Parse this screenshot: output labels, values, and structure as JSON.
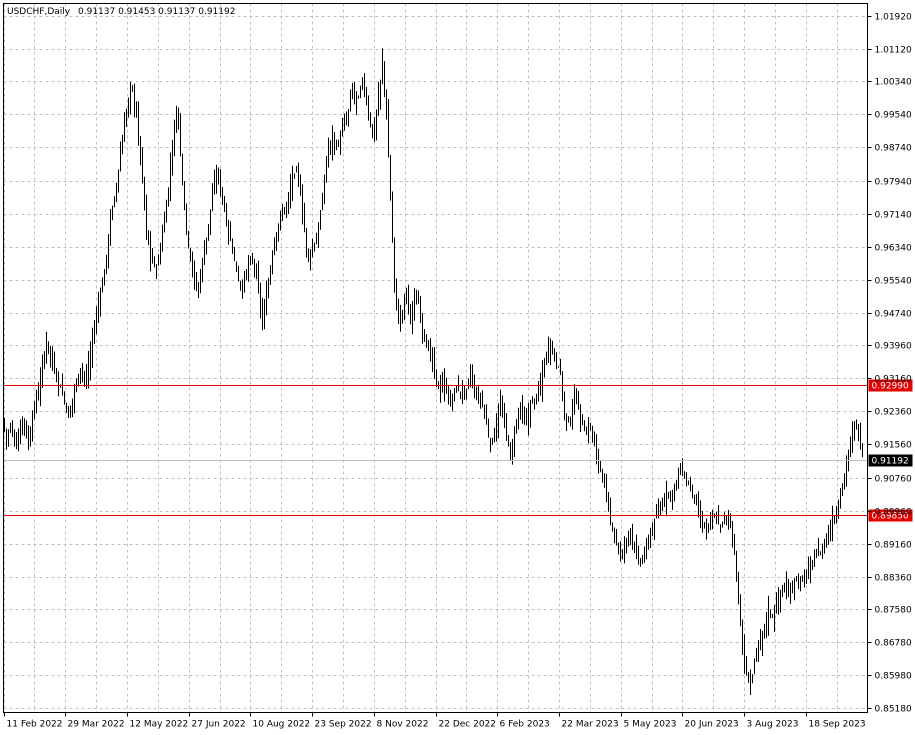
{
  "chart_data": {
    "type": "ohlc",
    "symbol_label": "USDCHF,Daily",
    "ohlc_label": "0.91137 0.91453 0.91137 0.91192",
    "last_price": 0.91192,
    "levels": [
      {
        "label": "0.92990",
        "value": 0.9299,
        "color": "#e00000"
      },
      {
        "label": "0.89850",
        "value": 0.8985,
        "color": "#e00000"
      }
    ],
    "y_ticks": [
      "1.01920",
      "1.01120",
      "1.00340",
      "0.99540",
      "0.98740",
      "0.97940",
      "0.97140",
      "0.96340",
      "0.95540",
      "0.94740",
      "0.93960",
      "0.93160",
      "0.92360",
      "0.91560",
      "0.90760",
      "0.89960",
      "0.89160",
      "0.88360",
      "0.87580",
      "0.86780",
      "0.85980",
      "0.85180"
    ],
    "x_ticks": [
      "11 Feb 2022",
      "29 Mar 2022",
      "12 May 2022",
      "27 Jun 2022",
      "10 Aug 2022",
      "23 Sep 2022",
      "8 Nov 2022",
      "22 Dec 2022",
      "6 Feb 2023",
      "22 Mar 2023",
      "5 May 2023",
      "20 Jun 2023",
      "3 Aug 2023",
      "18 Sep 2023"
    ],
    "ylim": [
      0.8508,
      1.0222
    ],
    "grid": true,
    "path_points": [
      [
        0,
        0.924
      ],
      [
        6,
        0.917
      ],
      [
        10,
        0.92
      ],
      [
        16,
        0.915
      ],
      [
        22,
        0.922
      ],
      [
        28,
        0.916
      ],
      [
        34,
        0.925
      ],
      [
        40,
        0.931
      ],
      [
        46,
        0.941
      ],
      [
        50,
        0.937
      ],
      [
        56,
        0.932
      ],
      [
        62,
        0.928
      ],
      [
        68,
        0.922
      ],
      [
        74,
        0.929
      ],
      [
        80,
        0.934
      ],
      [
        86,
        0.931
      ],
      [
        92,
        0.941
      ],
      [
        98,
        0.95
      ],
      [
        104,
        0.957
      ],
      [
        110,
        0.97
      ],
      [
        116,
        0.978
      ],
      [
        121,
        0.988
      ],
      [
        126,
        0.996
      ],
      [
        131,
        1.003
      ],
      [
        136,
        0.995
      ],
      [
        141,
        0.983
      ],
      [
        146,
        0.967
      ],
      [
        151,
        0.96
      ],
      [
        157,
        0.958
      ],
      [
        162,
        0.967
      ],
      [
        167,
        0.975
      ],
      [
        172,
        0.988
      ],
      [
        177,
        0.998
      ],
      [
        182,
        0.979
      ],
      [
        187,
        0.965
      ],
      [
        192,
        0.958
      ],
      [
        197,
        0.952
      ],
      [
        202,
        0.96
      ],
      [
        207,
        0.967
      ],
      [
        212,
        0.976
      ],
      [
        217,
        0.982
      ],
      [
        222,
        0.975
      ],
      [
        227,
        0.968
      ],
      [
        232,
        0.963
      ],
      [
        237,
        0.956
      ],
      [
        242,
        0.953
      ],
      [
        247,
        0.959
      ],
      [
        252,
        0.96
      ],
      [
        257,
        0.955
      ],
      [
        262,
        0.945
      ],
      [
        267,
        0.953
      ],
      [
        272,
        0.962
      ],
      [
        277,
        0.968
      ],
      [
        282,
        0.972
      ],
      [
        287,
        0.974
      ],
      [
        292,
        0.98
      ],
      [
        297,
        0.982
      ],
      [
        302,
        0.972
      ],
      [
        307,
        0.96
      ],
      [
        312,
        0.963
      ],
      [
        317,
        0.966
      ],
      [
        322,
        0.975
      ],
      [
        327,
        0.987
      ],
      [
        332,
        0.99
      ],
      [
        337,
        0.987
      ],
      [
        342,
        0.992
      ],
      [
        347,
        0.995
      ],
      [
        352,
        1.002
      ],
      [
        357,
        0.998
      ],
      [
        362,
        1.004
      ],
      [
        367,
        0.997
      ],
      [
        372,
        0.99
      ],
      [
        377,
        0.997
      ],
      [
        382,
        1.008
      ],
      [
        386,
        0.995
      ],
      [
        390,
        0.975
      ],
      [
        394,
        0.955
      ],
      [
        398,
        0.945
      ],
      [
        402,
        0.948
      ],
      [
        406,
        0.953
      ],
      [
        410,
        0.946
      ],
      [
        414,
        0.95
      ],
      [
        418,
        0.95
      ],
      [
        422,
        0.944
      ],
      [
        426,
        0.939
      ],
      [
        430,
        0.938
      ],
      [
        434,
        0.933
      ],
      [
        438,
        0.929
      ],
      [
        442,
        0.93
      ],
      [
        446,
        0.929
      ],
      [
        450,
        0.925
      ],
      [
        455,
        0.93
      ],
      [
        460,
        0.928
      ],
      [
        465,
        0.928
      ],
      [
        470,
        0.933
      ],
      [
        475,
        0.927
      ],
      [
        480,
        0.927
      ],
      [
        485,
        0.922
      ],
      [
        490,
        0.915
      ],
      [
        495,
        0.92
      ],
      [
        500,
        0.925
      ],
      [
        505,
        0.92
      ],
      [
        510,
        0.912
      ],
      [
        515,
        0.92
      ],
      [
        520,
        0.925
      ],
      [
        525,
        0.92
      ],
      [
        530,
        0.925
      ],
      [
        535,
        0.927
      ],
      [
        540,
        0.93
      ],
      [
        545,
        0.937
      ],
      [
        550,
        0.94
      ],
      [
        555,
        0.936
      ],
      [
        560,
        0.933
      ],
      [
        565,
        0.92
      ],
      [
        570,
        0.922
      ],
      [
        575,
        0.928
      ],
      [
        580,
        0.922
      ],
      [
        585,
        0.918
      ],
      [
        590,
        0.92
      ],
      [
        595,
        0.914
      ],
      [
        600,
        0.91
      ],
      [
        605,
        0.904
      ],
      [
        610,
        0.897
      ],
      [
        615,
        0.893
      ],
      [
        620,
        0.888
      ],
      [
        625,
        0.892
      ],
      [
        630,
        0.895
      ],
      [
        635,
        0.889
      ],
      [
        640,
        0.887
      ],
      [
        645,
        0.89
      ],
      [
        650,
        0.894
      ],
      [
        655,
        0.898
      ],
      [
        660,
        0.9
      ],
      [
        665,
        0.904
      ],
      [
        670,
        0.903
      ],
      [
        675,
        0.906
      ],
      [
        680,
        0.91
      ],
      [
        685,
        0.907
      ],
      [
        690,
        0.905
      ],
      [
        695,
        0.902
      ],
      [
        700,
        0.897
      ],
      [
        705,
        0.895
      ],
      [
        710,
        0.897
      ],
      [
        715,
        0.898
      ],
      [
        720,
        0.896
      ],
      [
        725,
        0.898
      ],
      [
        730,
        0.897
      ],
      [
        735,
        0.887
      ],
      [
        740,
        0.872
      ],
      [
        744,
        0.862
      ],
      [
        748,
        0.858
      ],
      [
        752,
        0.86
      ],
      [
        756,
        0.866
      ],
      [
        760,
        0.868
      ],
      [
        764,
        0.872
      ],
      [
        768,
        0.875
      ],
      [
        772,
        0.874
      ],
      [
        776,
        0.877
      ],
      [
        780,
        0.88
      ],
      [
        784,
        0.881
      ],
      [
        788,
        0.879
      ],
      [
        792,
        0.882
      ],
      [
        796,
        0.883
      ],
      [
        800,
        0.882
      ],
      [
        804,
        0.884
      ],
      [
        808,
        0.885
      ],
      [
        812,
        0.887
      ],
      [
        816,
        0.89
      ],
      [
        820,
        0.889
      ],
      [
        824,
        0.892
      ],
      [
        828,
        0.894
      ],
      [
        832,
        0.897
      ],
      [
        836,
        0.899
      ],
      [
        840,
        0.904
      ],
      [
        844,
        0.908
      ],
      [
        848,
        0.914
      ],
      [
        852,
        0.918
      ],
      [
        856,
        0.921
      ],
      [
        860,
        0.916
      ],
      [
        863,
        0.912
      ]
    ]
  }
}
